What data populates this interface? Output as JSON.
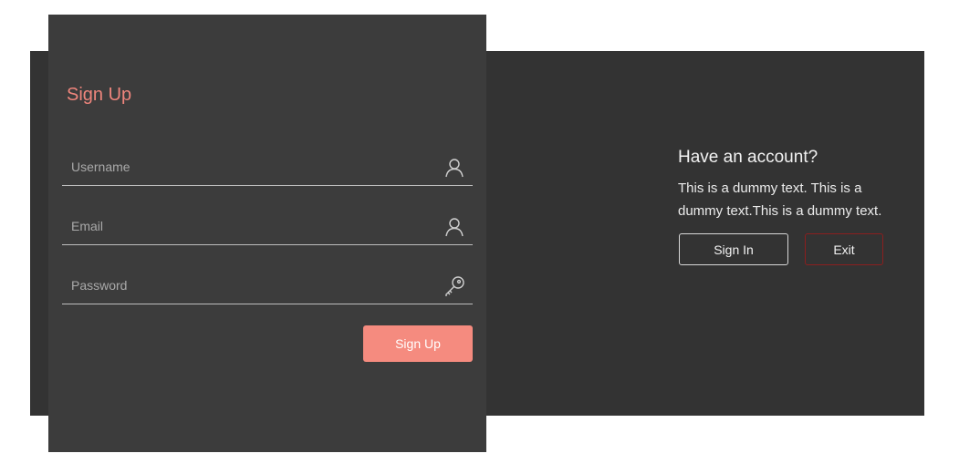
{
  "signup_form": {
    "title": "Sign Up",
    "title_color": "#ef857c",
    "fields": [
      {
        "placeholder": "Username",
        "value": "",
        "icon": "user-icon"
      },
      {
        "placeholder": "Email",
        "value": "",
        "icon": "user-icon"
      },
      {
        "placeholder": "Password",
        "value": "",
        "icon": "key-icon"
      }
    ],
    "submit_label": "Sign Up",
    "submit_color": "#f58b7f"
  },
  "info_panel": {
    "heading": "Have an account?",
    "text": "This is a dummy text. This is a dummy text.This is a dummy text.",
    "signin_label": "Sign In",
    "exit_label": "Exit",
    "exit_border_color": "#8b1f1f"
  }
}
